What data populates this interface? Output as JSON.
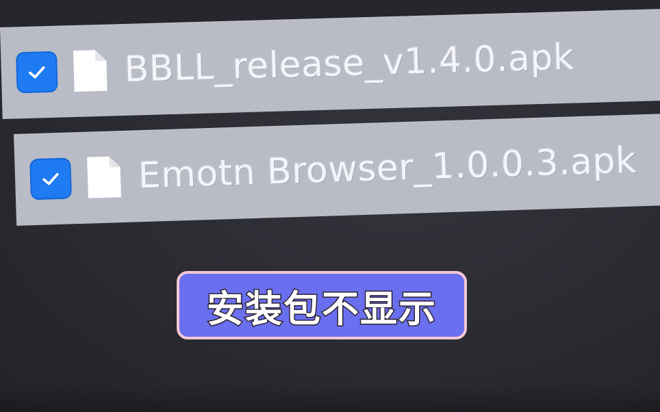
{
  "files": [
    {
      "name": "BBLL_release_v1.4.0.apk",
      "checked": true,
      "icon": "file-icon"
    },
    {
      "name": "Emotn Browser_1.0.0.3.apk",
      "checked": true,
      "icon": "file-icon"
    }
  ],
  "caption": {
    "text": "安装包不显示"
  },
  "colors": {
    "row_bg": "#b9bcc6",
    "checkbox": "#1e7bf2",
    "caption_bg": "#6a6ff0",
    "caption_border": "#f3c7d4",
    "screen_bg": "#2a2a31"
  }
}
